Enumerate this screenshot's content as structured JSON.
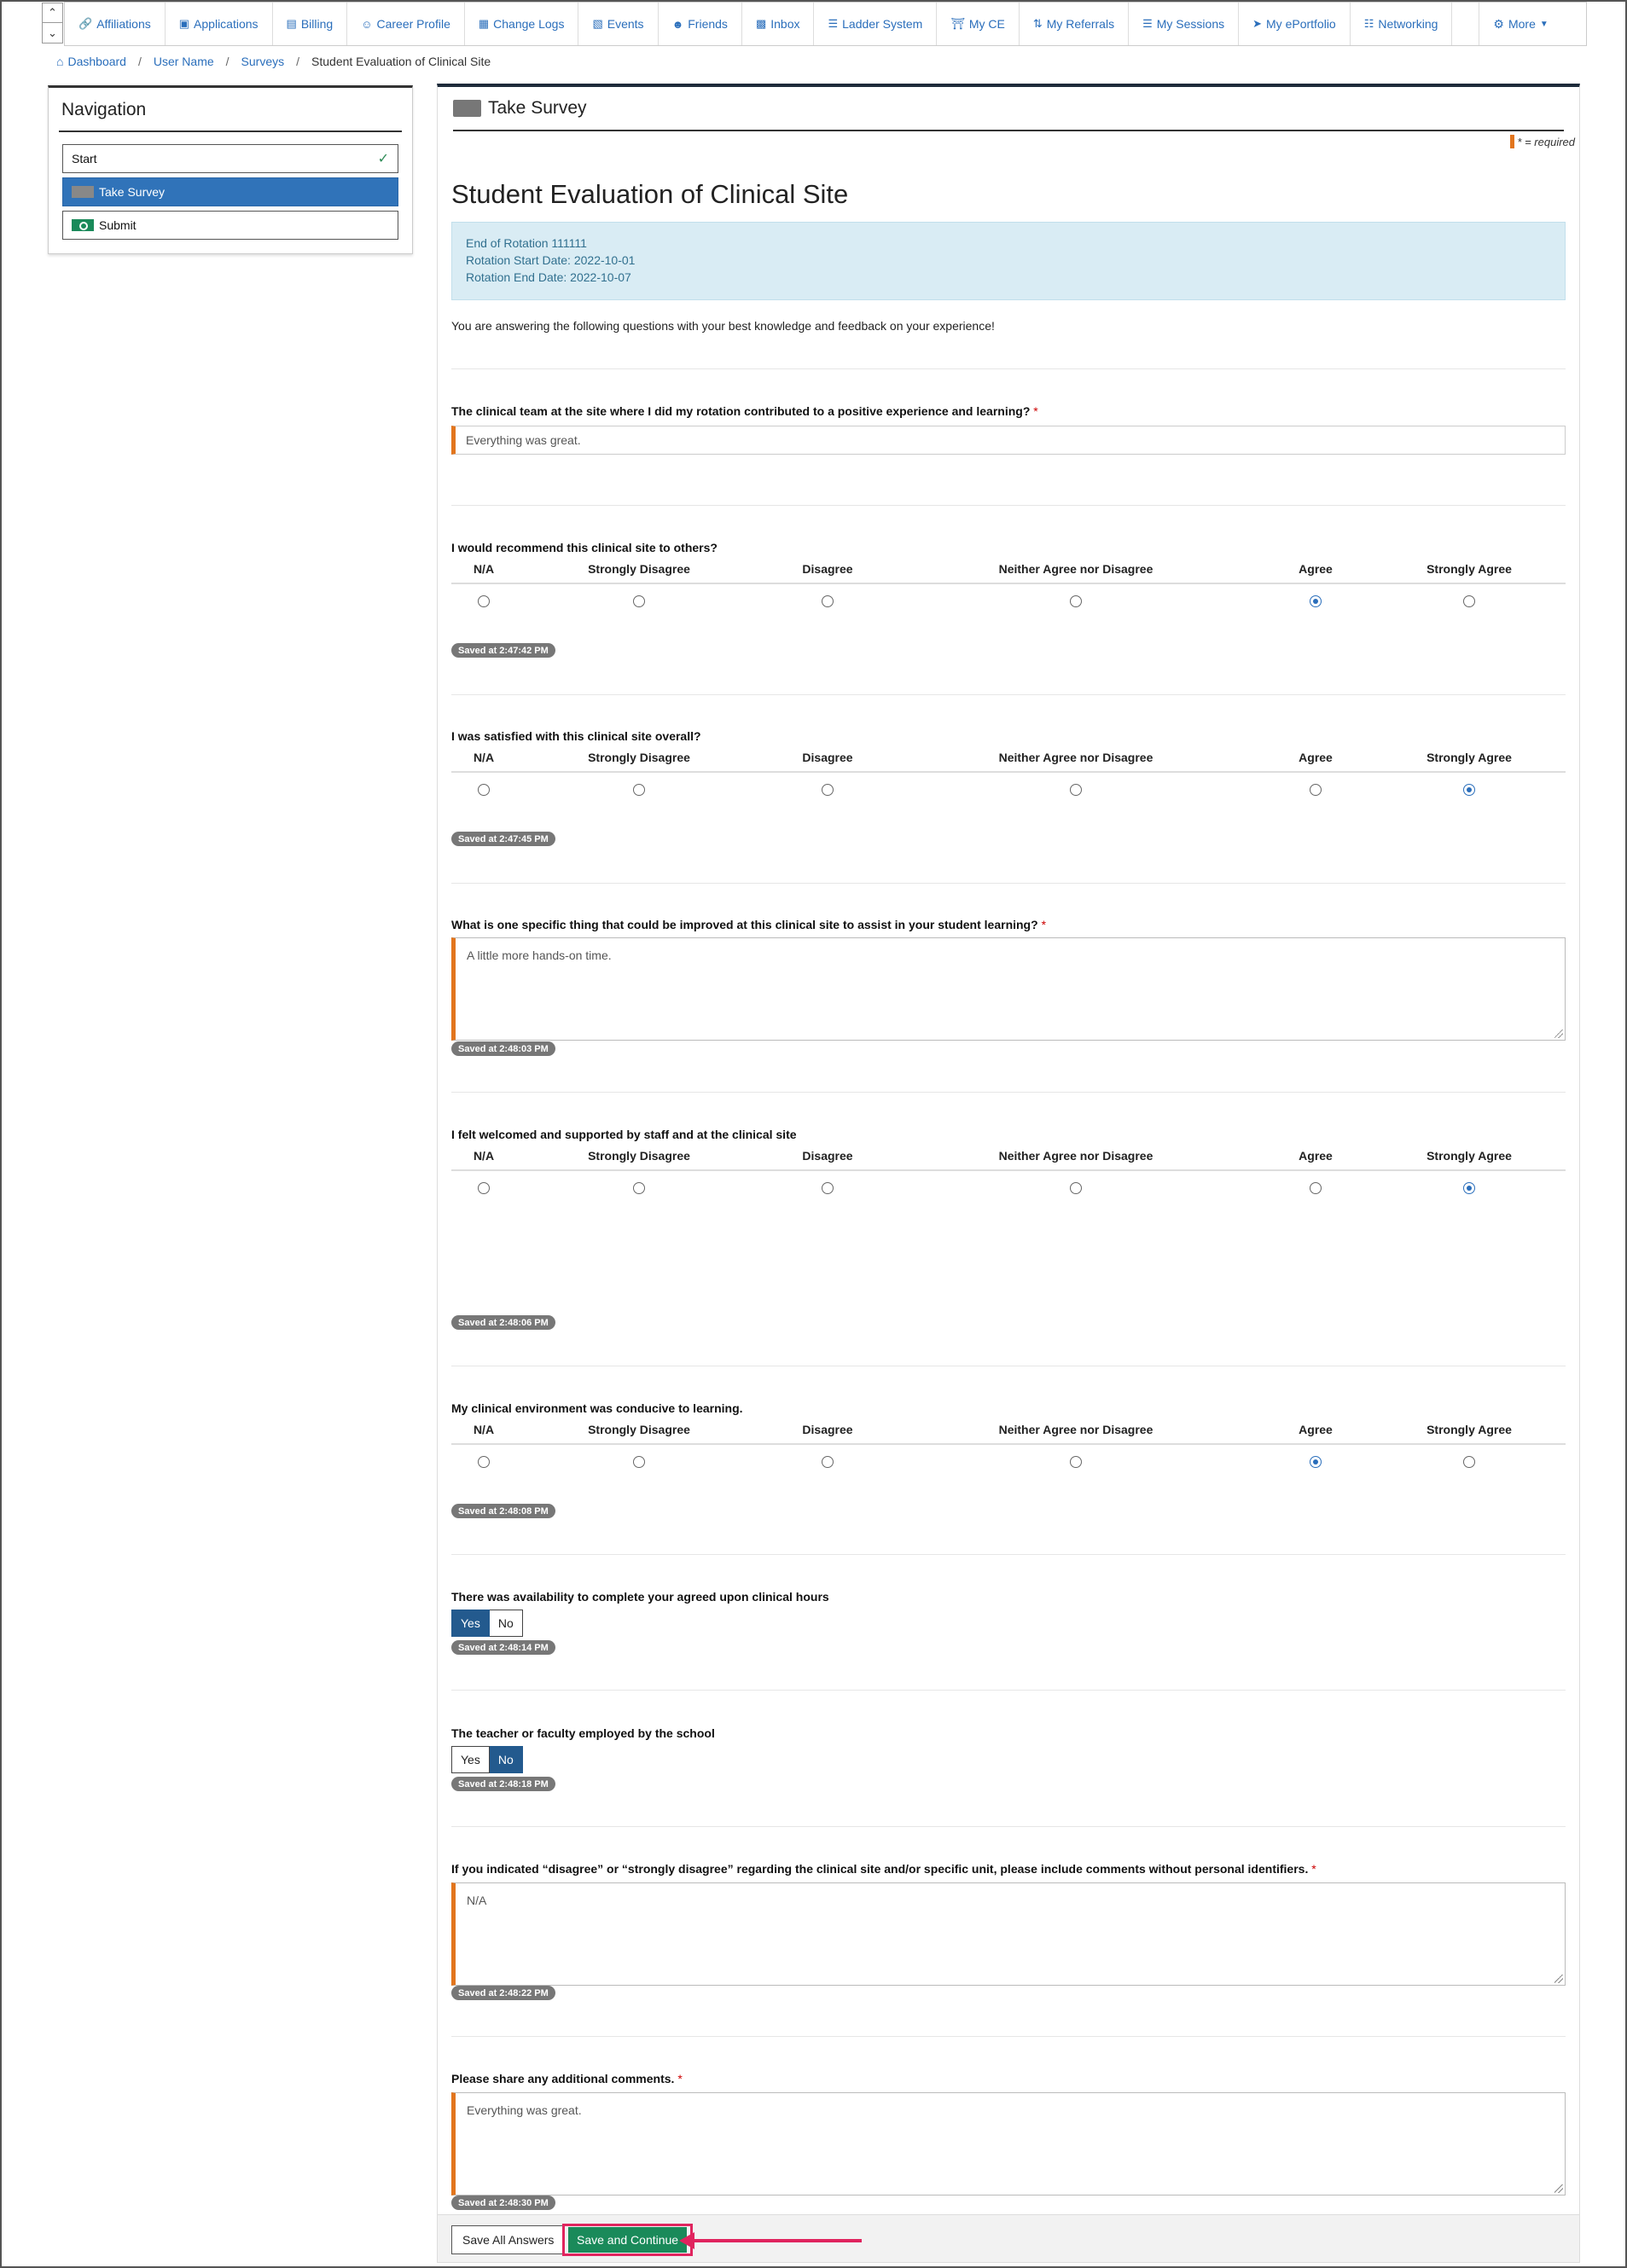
{
  "topnav": {
    "items": [
      {
        "label": "Affiliations",
        "icon": "link-icon"
      },
      {
        "label": "Applications",
        "icon": "id-card-icon"
      },
      {
        "label": "Billing",
        "icon": "money-icon"
      },
      {
        "label": "Career Profile",
        "icon": "user-icon"
      },
      {
        "label": "Change Logs",
        "icon": "cubes-icon"
      },
      {
        "label": "Events",
        "icon": "calendar-icon"
      },
      {
        "label": "Friends",
        "icon": "users-icon"
      },
      {
        "label": "Inbox",
        "icon": "inbox-icon"
      },
      {
        "label": "Ladder System",
        "icon": "ladder-icon"
      },
      {
        "label": "My CE",
        "icon": "institution-icon"
      },
      {
        "label": "My Referrals",
        "icon": "retweet-icon"
      },
      {
        "label": "My Sessions",
        "icon": "list-icon"
      },
      {
        "label": "My ePortfolio",
        "icon": "rocket-icon"
      },
      {
        "label": "Networking",
        "icon": "sitemap-icon"
      }
    ],
    "more_label": "More"
  },
  "breadcrumb": [
    "Dashboard",
    "User Name",
    "Surveys",
    "Student Evaluation of Clinical Site"
  ],
  "nav": {
    "title": "Navigation",
    "items": [
      {
        "label": "Start"
      },
      {
        "label": "Take Survey"
      },
      {
        "label": "Submit"
      }
    ]
  },
  "panel": {
    "header": "Take Survey",
    "required_note": "* = required",
    "survey_title": "Student Evaluation of Clinical Site",
    "info": {
      "line1": "End of Rotation 111111",
      "line2": "Rotation Start Date: 2022-10-01",
      "line3": "Rotation End Date: 2022-10-07"
    },
    "intro": "You are answering the following questions with your best knowledge and feedback on your experience!"
  },
  "likert_options": [
    "N/A",
    "Strongly Disagree",
    "Disagree",
    "Neither Agree nor Disagree",
    "Agree",
    "Strongly Agree"
  ],
  "questions": {
    "q1": {
      "label": "The clinical team at the site where I did my rotation contributed to a positive experience and learning?",
      "required": "*",
      "value": "Everything was great."
    },
    "q2": {
      "label": "I would recommend this clinical site to others?",
      "selected": "Agree",
      "saved": "Saved at 2:47:42 PM"
    },
    "q3": {
      "label": "I was satisfied with this clinical site overall?",
      "selected": "Strongly Agree",
      "saved": "Saved at 2:47:45 PM"
    },
    "q4": {
      "label": "What is one specific thing that could be improved at this clinical site to assist in your student learning?",
      "required": "*",
      "value": "A little more hands-on time.",
      "saved": "Saved at 2:48:03 PM"
    },
    "q5": {
      "label": "I felt welcomed and supported by staff and at the clinical site",
      "selected": "Strongly Agree",
      "saved": "Saved at 2:48:06 PM"
    },
    "q6": {
      "label": "My clinical environment was conducive to learning.",
      "selected": "Agree",
      "saved": "Saved at 2:48:08 PM"
    },
    "q7": {
      "label": "There was availability to complete your agreed upon clinical hours",
      "yes": "Yes",
      "no": "No",
      "selected": "Yes",
      "saved": "Saved at 2:48:14 PM"
    },
    "q8": {
      "label": "The teacher or faculty employed by the school",
      "yes": "Yes",
      "no": "No",
      "selected": "No",
      "saved": "Saved at 2:48:18 PM"
    },
    "q9": {
      "label": "If you indicated “disagree” or “strongly disagree” regarding the clinical site and/or specific unit, please include comments without personal identifiers.",
      "required": "*",
      "value": "N/A",
      "saved": "Saved at 2:48:22 PM"
    },
    "q10": {
      "label": "Please share any additional comments.",
      "required": "*",
      "value": "Everything was great.",
      "saved": "Saved at 2:48:30 PM"
    }
  },
  "footer": {
    "save_all": "Save All Answers",
    "save_continue": "Save and Continue"
  },
  "colors": {
    "primary": "#3073b9",
    "link": "#2a6ebb",
    "required_bar": "#e2751d",
    "success": "#1a8a5a",
    "highlight": "#e0245e",
    "info_bg": "#d9ecf4"
  }
}
